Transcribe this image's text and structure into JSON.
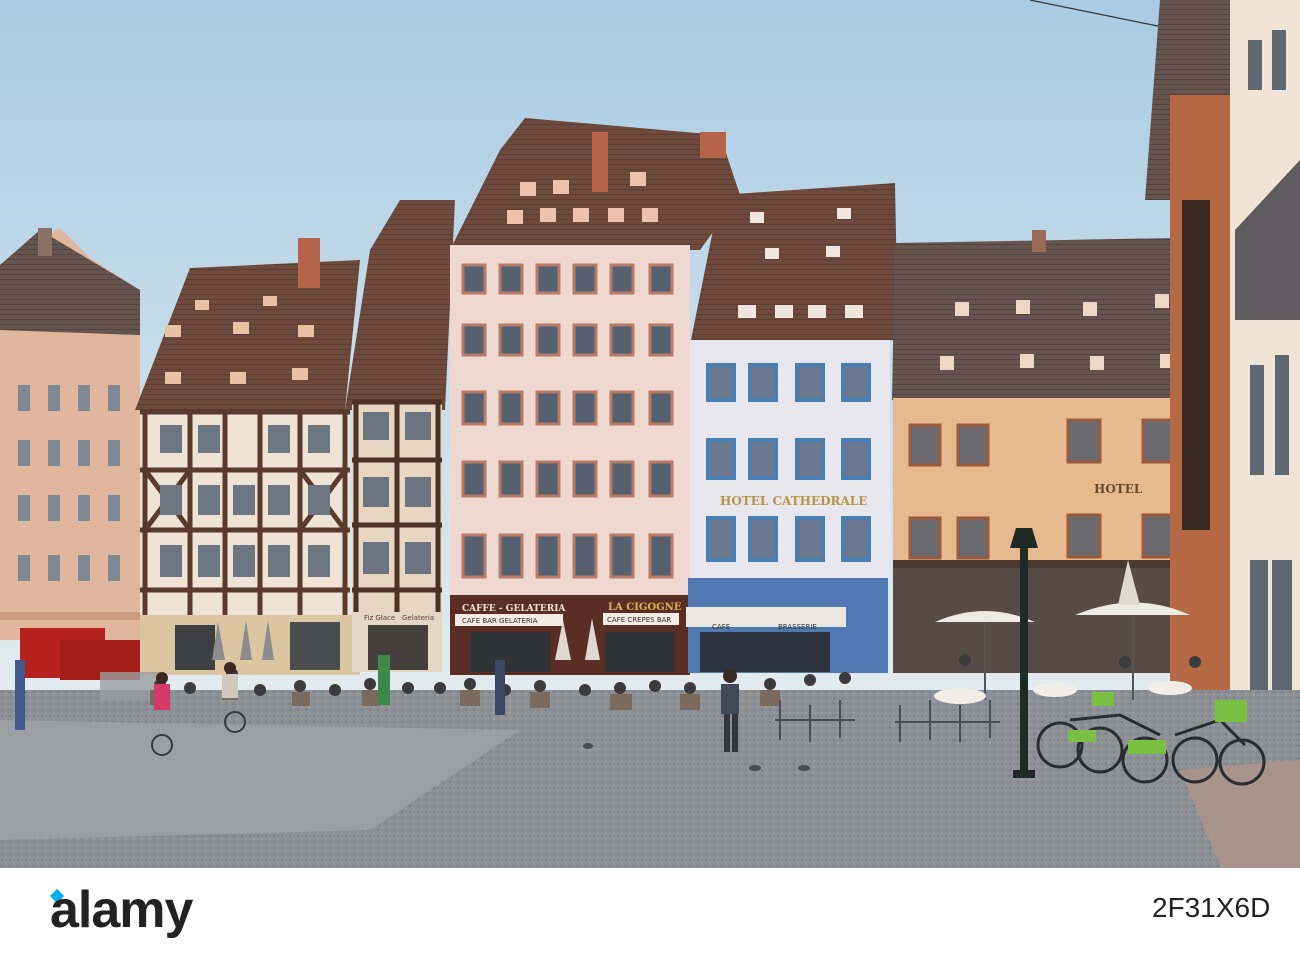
{
  "photo": {
    "signs": {
      "caffe_gelateria": "CAFFE - GELATERIA",
      "fiz_glace": "Fiz Glace",
      "gelateria_small": "Gelateria",
      "cafe_bar_gelateria": "CAFE BAR GELATERIA",
      "la_cigogne": "LA CIGOGNE",
      "cafe_crepes_bar": "CAFE CREPES BAR",
      "hotel_cathedrale": "HOTEL CATHEDRALE",
      "hotel_right": "HOTEL",
      "cafe": "CAFE",
      "brasserie": "BRASSERIE"
    },
    "colors": {
      "sky": "#b9d5e8",
      "pavement": "#8e9196",
      "half_timber": "#5a3a2c",
      "roof": "#6f4a3c"
    }
  },
  "watermark": {
    "brand": "alamy",
    "image_id": "2F31X6D"
  }
}
